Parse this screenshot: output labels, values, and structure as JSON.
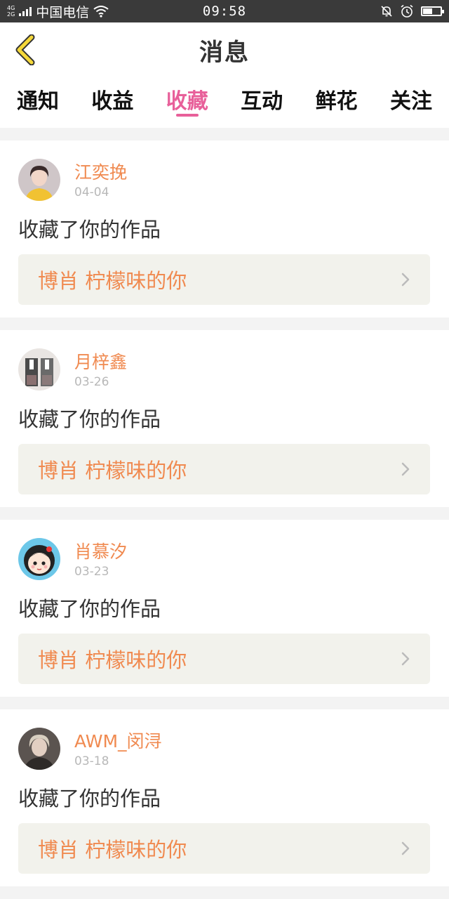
{
  "status_bar": {
    "network_top": "4G",
    "network_bottom": "2G",
    "carrier": "中国电信",
    "time": "09:58",
    "battery_level": 0.55,
    "icons": [
      "signal-icon",
      "wifi-icon",
      "mute-icon",
      "alarm-icon",
      "battery-icon"
    ]
  },
  "header": {
    "title": "消息",
    "back_icon": "chevron-left-icon",
    "accent_color": "#f5d83a"
  },
  "tabs": [
    {
      "label": "通知",
      "active": false
    },
    {
      "label": "收益",
      "active": false
    },
    {
      "label": "收藏",
      "active": true
    },
    {
      "label": "互动",
      "active": false
    },
    {
      "label": "鲜花",
      "active": false
    },
    {
      "label": "关注",
      "active": false
    }
  ],
  "tab_active_color": "#e8609a",
  "messages": [
    {
      "author": "江奕挽",
      "date": "04-04",
      "action": "收藏了你的作品",
      "work_title": "博肖 柠檬味的你",
      "avatar_icon": "avatar-yellow-shirt"
    },
    {
      "author": "月梓鑫",
      "date": "03-26",
      "action": "收藏了你的作品",
      "work_title": "博肖 柠檬味的你",
      "avatar_icon": "avatar-school-uniform"
    },
    {
      "author": "肖慕汐",
      "date": "03-23",
      "action": "收藏了你的作品",
      "work_title": "博肖 柠檬味的你",
      "avatar_icon": "avatar-cartoon-girl"
    },
    {
      "author": "AWM_闵浔",
      "date": "03-18",
      "action": "收藏了你的作品",
      "work_title": "博肖 柠檬味的你",
      "avatar_icon": "avatar-portrait"
    }
  ],
  "colors": {
    "author": "#f08a50",
    "work_title": "#f08a50",
    "date": "#b8b8b8",
    "card_link_bg": "#f2f2ec"
  }
}
